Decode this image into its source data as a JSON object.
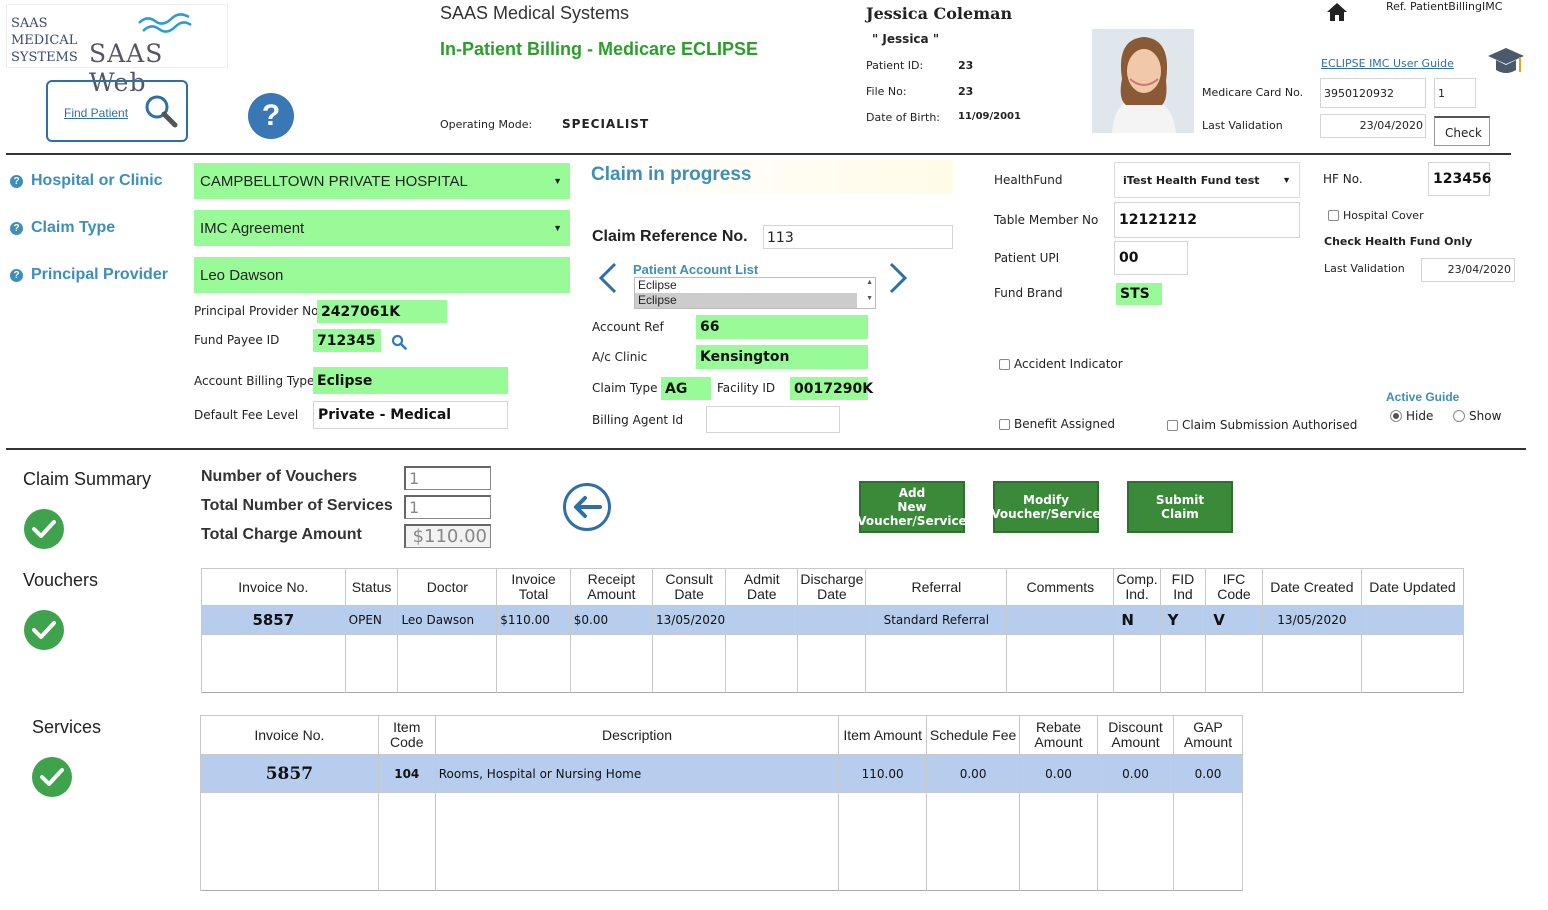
{
  "logo": {
    "company_text": [
      "SAAS",
      "MEDICAL",
      "SYSTEMS"
    ],
    "product": "SAAS Web"
  },
  "header": {
    "company": "SAAS Medical Systems",
    "title": "In-Patient Billing - Medicare ECLIPSE",
    "find_patient": "Find Patient",
    "operating_mode_label": "Operating Mode:",
    "operating_mode": "SPECIALIST",
    "ref": "Ref. PatientBillingIMC",
    "user_guide": "ECLIPSE IMC User Guide"
  },
  "patient": {
    "name": "Jessica Coleman",
    "nickname": "\" Jessica \"",
    "id_label": "Patient ID:",
    "id": "23",
    "file_label": "File No:",
    "file": "23",
    "dob_label": "Date of Birth:",
    "dob": "11/09/2001",
    "medicare_label": "Medicare Card No.",
    "medicare_no": "3950120932",
    "medicare_irn": "1",
    "last_validation_label": "Last Validation",
    "last_validation": "23/04/2020",
    "check_button": "Check"
  },
  "claim": {
    "hospital_label": "Hospital or Clinic",
    "hospital": "CAMPBELLTOWN PRIVATE HOSPITAL",
    "claim_type_label": "Claim Type",
    "claim_type": "IMC Agreement",
    "principal_label": "Principal Provider",
    "principal": "Leo Dawson",
    "provider_no_label": "Principal Provider No.",
    "provider_no": "2427061K",
    "fund_payee_label": "Fund Payee ID",
    "fund_payee": "712345",
    "billing_type_label": "Account Billing Type",
    "billing_type": "Eclipse",
    "fee_level_label": "Default Fee Level",
    "fee_level": "Private - Medical"
  },
  "progress": {
    "status": "Claim in progress",
    "ref_label": "Claim Reference No.",
    "ref_no": "113",
    "account_list_label": "Patient Account List",
    "account_list": [
      "Eclipse",
      "Eclipse"
    ],
    "account_ref_label": "Account Ref",
    "account_ref": "66",
    "ac_clinic_label": "A/c Clinic",
    "ac_clinic": "Kensington",
    "claim_type_label": "Claim Type",
    "claim_type_code": "AG",
    "facility_label": "Facility ID",
    "facility_id": "0017290K",
    "billing_agent_label": "Billing Agent Id",
    "billing_agent": ""
  },
  "fund": {
    "healthfund_label": "HealthFund",
    "healthfund": "iTest Health Fund test",
    "hf_no_label": "HF No.",
    "hf_no": "123456",
    "table_member_label": "Table Member No",
    "table_member": "12121212",
    "hospital_cover_label": "Hospital Cover",
    "check_fund_only": "Check Health Fund Only",
    "patient_upi_label": "Patient UPI",
    "patient_upi": "00",
    "last_validation_label": "Last Validation",
    "last_validation": "23/04/2020",
    "fund_brand_label": "Fund Brand",
    "fund_brand": "STS",
    "accident_label": "Accident Indicator",
    "benefit_label": "Benefit Assigned",
    "submission_label": "Claim Submission Authorised",
    "active_guide_label": "Active Guide",
    "hide_label": "Hide",
    "show_label": "Show"
  },
  "summary": {
    "title": "Claim Summary",
    "vouchers_label": "Number of Vouchers",
    "vouchers": "1",
    "services_label": "Total Number of Services",
    "services": "1",
    "charge_label": "Total Charge Amount",
    "charge": "$110.00",
    "btn_add": [
      "Add",
      "New",
      "Voucher/Service"
    ],
    "btn_modify": [
      "Modify",
      "Voucher/Service"
    ],
    "btn_submit": [
      "Submit",
      "Claim"
    ]
  },
  "sections": {
    "vouchers": "Vouchers",
    "services": "Services"
  },
  "vouchers_table": {
    "headers": [
      [
        "Invoice No."
      ],
      [
        "Status"
      ],
      [
        "Doctor"
      ],
      [
        "Invoice",
        "Total"
      ],
      [
        "Receipt",
        "Amount"
      ],
      [
        "Consult",
        "Date"
      ],
      [
        "Admit Date"
      ],
      [
        "Discharge",
        "Date"
      ],
      [
        "Referral"
      ],
      [
        "Comments"
      ],
      [
        "Comp.",
        "Ind."
      ],
      [
        "FID Ind"
      ],
      [
        "IFC",
        "Code"
      ],
      [
        "Date Created"
      ],
      [
        "Date Updated"
      ]
    ],
    "rows": [
      [
        "5857",
        "OPEN",
        "Leo Dawson",
        "$110.00",
        "$0.00",
        "13/05/2020",
        "",
        "",
        "Standard Referral",
        "",
        "N",
        "Y",
        "V",
        "13/05/2020",
        ""
      ]
    ]
  },
  "services_table": {
    "headers": [
      [
        "Invoice No."
      ],
      [
        "Item",
        "Code"
      ],
      [
        "Description"
      ],
      [
        "Item Amount"
      ],
      [
        "Schedule Fee"
      ],
      [
        "Rebate",
        "Amount"
      ],
      [
        "Discount",
        "Amount"
      ],
      [
        "GAP",
        "Amount"
      ]
    ],
    "rows": [
      [
        "5857",
        "104",
        "Rooms, Hospital or Nursing Home",
        "110.00",
        "0.00",
        "0.00",
        "0.00",
        "0.00"
      ]
    ]
  }
}
